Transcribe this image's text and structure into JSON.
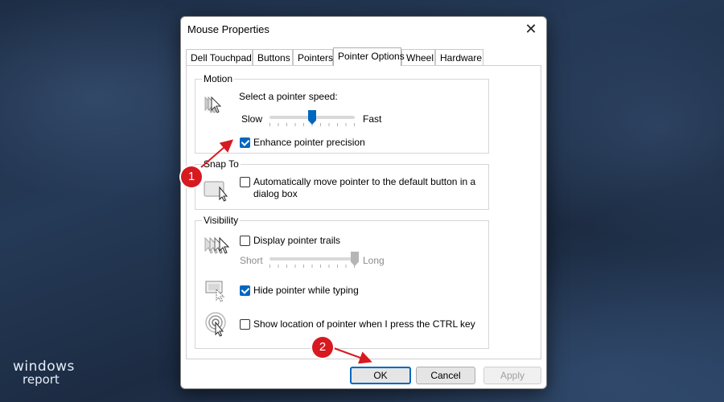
{
  "window": {
    "title": "Mouse Properties",
    "close_glyph": "✕"
  },
  "tabs": [
    {
      "label": "Dell Touchpad",
      "active": false
    },
    {
      "label": "Buttons",
      "active": false
    },
    {
      "label": "Pointers",
      "active": false
    },
    {
      "label": "Pointer Options",
      "active": true
    },
    {
      "label": "Wheel",
      "active": false
    },
    {
      "label": "Hardware",
      "active": false
    }
  ],
  "motion": {
    "group_label": "Motion",
    "speed_label": "Select a pointer speed:",
    "slow_label": "Slow",
    "fast_label": "Fast",
    "speed_level": 0.5,
    "precision_label": "Enhance pointer precision",
    "precision_checked": true,
    "icon": "pointer-speed-icon"
  },
  "snap_to": {
    "group_label": "Snap To",
    "auto_move_label_line1": "Automatically move pointer to the default button in a",
    "auto_move_label_line2": "dialog box",
    "auto_move_checked": false,
    "icon": "snap-to-button-icon"
  },
  "visibility": {
    "group_label": "Visibility",
    "trails_label": "Display pointer trails",
    "trails_checked": false,
    "short_label": "Short",
    "long_label": "Long",
    "trails_level": 1.0,
    "hide_typing_label": "Hide pointer while typing",
    "hide_typing_checked": true,
    "show_location_label": "Show location of pointer when I press the CTRL key",
    "show_location_checked": false,
    "icons": [
      "pointer-trails-icon",
      "hide-pointer-icon",
      "show-location-icon"
    ]
  },
  "buttons": {
    "ok": "OK",
    "cancel": "Cancel",
    "apply": "Apply"
  },
  "annotations": {
    "marker1": "1",
    "marker2": "2",
    "color": "#d71920"
  },
  "brand": {
    "line1": "windows",
    "line2": "report"
  },
  "colors": {
    "accent": "#0067c0"
  }
}
